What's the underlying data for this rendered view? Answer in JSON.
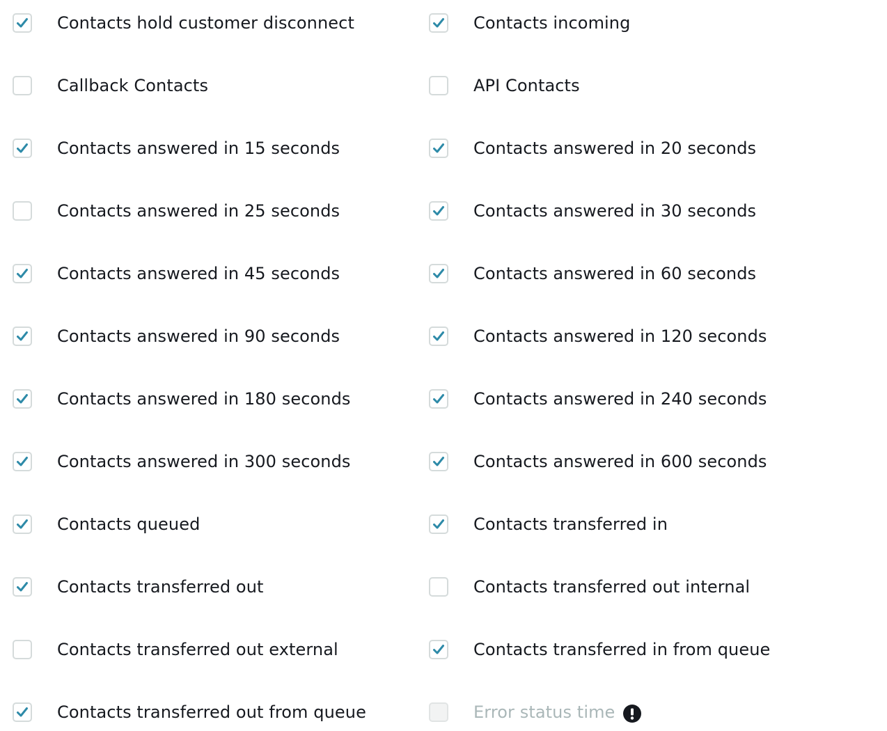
{
  "accent_color": "#0073bb",
  "check_color": "#2d8aa8",
  "left_column": [
    {
      "label": "Contacts hold customer disconnect",
      "checked": true
    },
    {
      "label": "Callback Contacts",
      "checked": false
    },
    {
      "label": "Contacts answered in 15 seconds",
      "checked": true
    },
    {
      "label": "Contacts answered in 25 seconds",
      "checked": false
    },
    {
      "label": "Contacts answered in 45 seconds",
      "checked": true
    },
    {
      "label": "Contacts answered in 90 seconds",
      "checked": true
    },
    {
      "label": "Contacts answered in 180 seconds",
      "checked": true
    },
    {
      "label": "Contacts answered in 300 seconds",
      "checked": true
    },
    {
      "label": "Contacts queued",
      "checked": true
    },
    {
      "label": "Contacts transferred out",
      "checked": true
    },
    {
      "label": "Contacts transferred out external",
      "checked": false
    },
    {
      "label": "Contacts transferred out from queue",
      "checked": true
    }
  ],
  "right_column": [
    {
      "label": "Contacts incoming",
      "checked": true
    },
    {
      "label": "API Contacts",
      "checked": false
    },
    {
      "label": "Contacts answered in 20 seconds",
      "checked": true
    },
    {
      "label": "Contacts answered in 30 seconds",
      "checked": true
    },
    {
      "label": "Contacts answered in 60 seconds",
      "checked": true
    },
    {
      "label": "Contacts answered in 120 seconds",
      "checked": true
    },
    {
      "label": "Contacts answered in 240 seconds",
      "checked": true
    },
    {
      "label": "Contacts answered in 600 seconds",
      "checked": true
    },
    {
      "label": "Contacts transferred in",
      "checked": true
    },
    {
      "label": "Contacts transferred out internal",
      "checked": false
    },
    {
      "label": "Contacts transferred in from queue",
      "checked": true
    },
    {
      "label": "Error status time",
      "checked": false,
      "disabled": true,
      "icon": "exclamation-circle-icon"
    }
  ]
}
